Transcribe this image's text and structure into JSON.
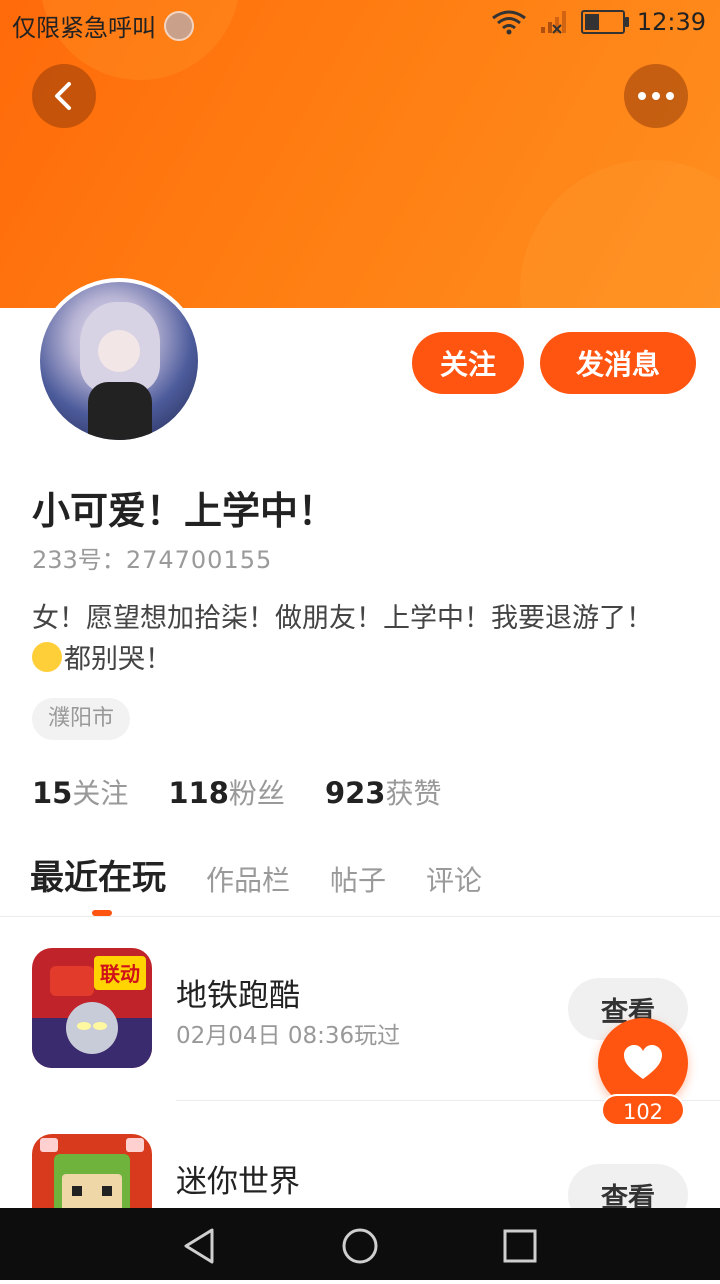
{
  "status_bar": {
    "carrier": "仅限紧急呼叫",
    "time": "12:39"
  },
  "profile": {
    "follow_label": "关注",
    "message_label": "发消息",
    "name": "小可爱！上学中！",
    "id_label": "233号：",
    "id_value": "274700155",
    "bio_line1": "女！愿望想加拾柒！做朋友！上学中！我要退游了！",
    "bio_line2": "都别哭！",
    "location": "濮阳市",
    "stats": {
      "following_count": "15",
      "following_label": "关注",
      "fans_count": "118",
      "fans_label": "粉丝",
      "likes_count": "923",
      "likes_label": "获赞"
    }
  },
  "tabs": [
    "最近在玩",
    "作品栏",
    "帖子",
    "评论"
  ],
  "games": [
    {
      "title": "地铁跑酷",
      "time": "02月04日 08:36玩过",
      "action": "查看",
      "badge": "联动"
    },
    {
      "title": "迷你世界",
      "time": "",
      "action": "查看"
    }
  ],
  "like_fab": {
    "count": "102"
  },
  "colors": {
    "accent": "#ff5511",
    "banner": "#ff7d12"
  }
}
